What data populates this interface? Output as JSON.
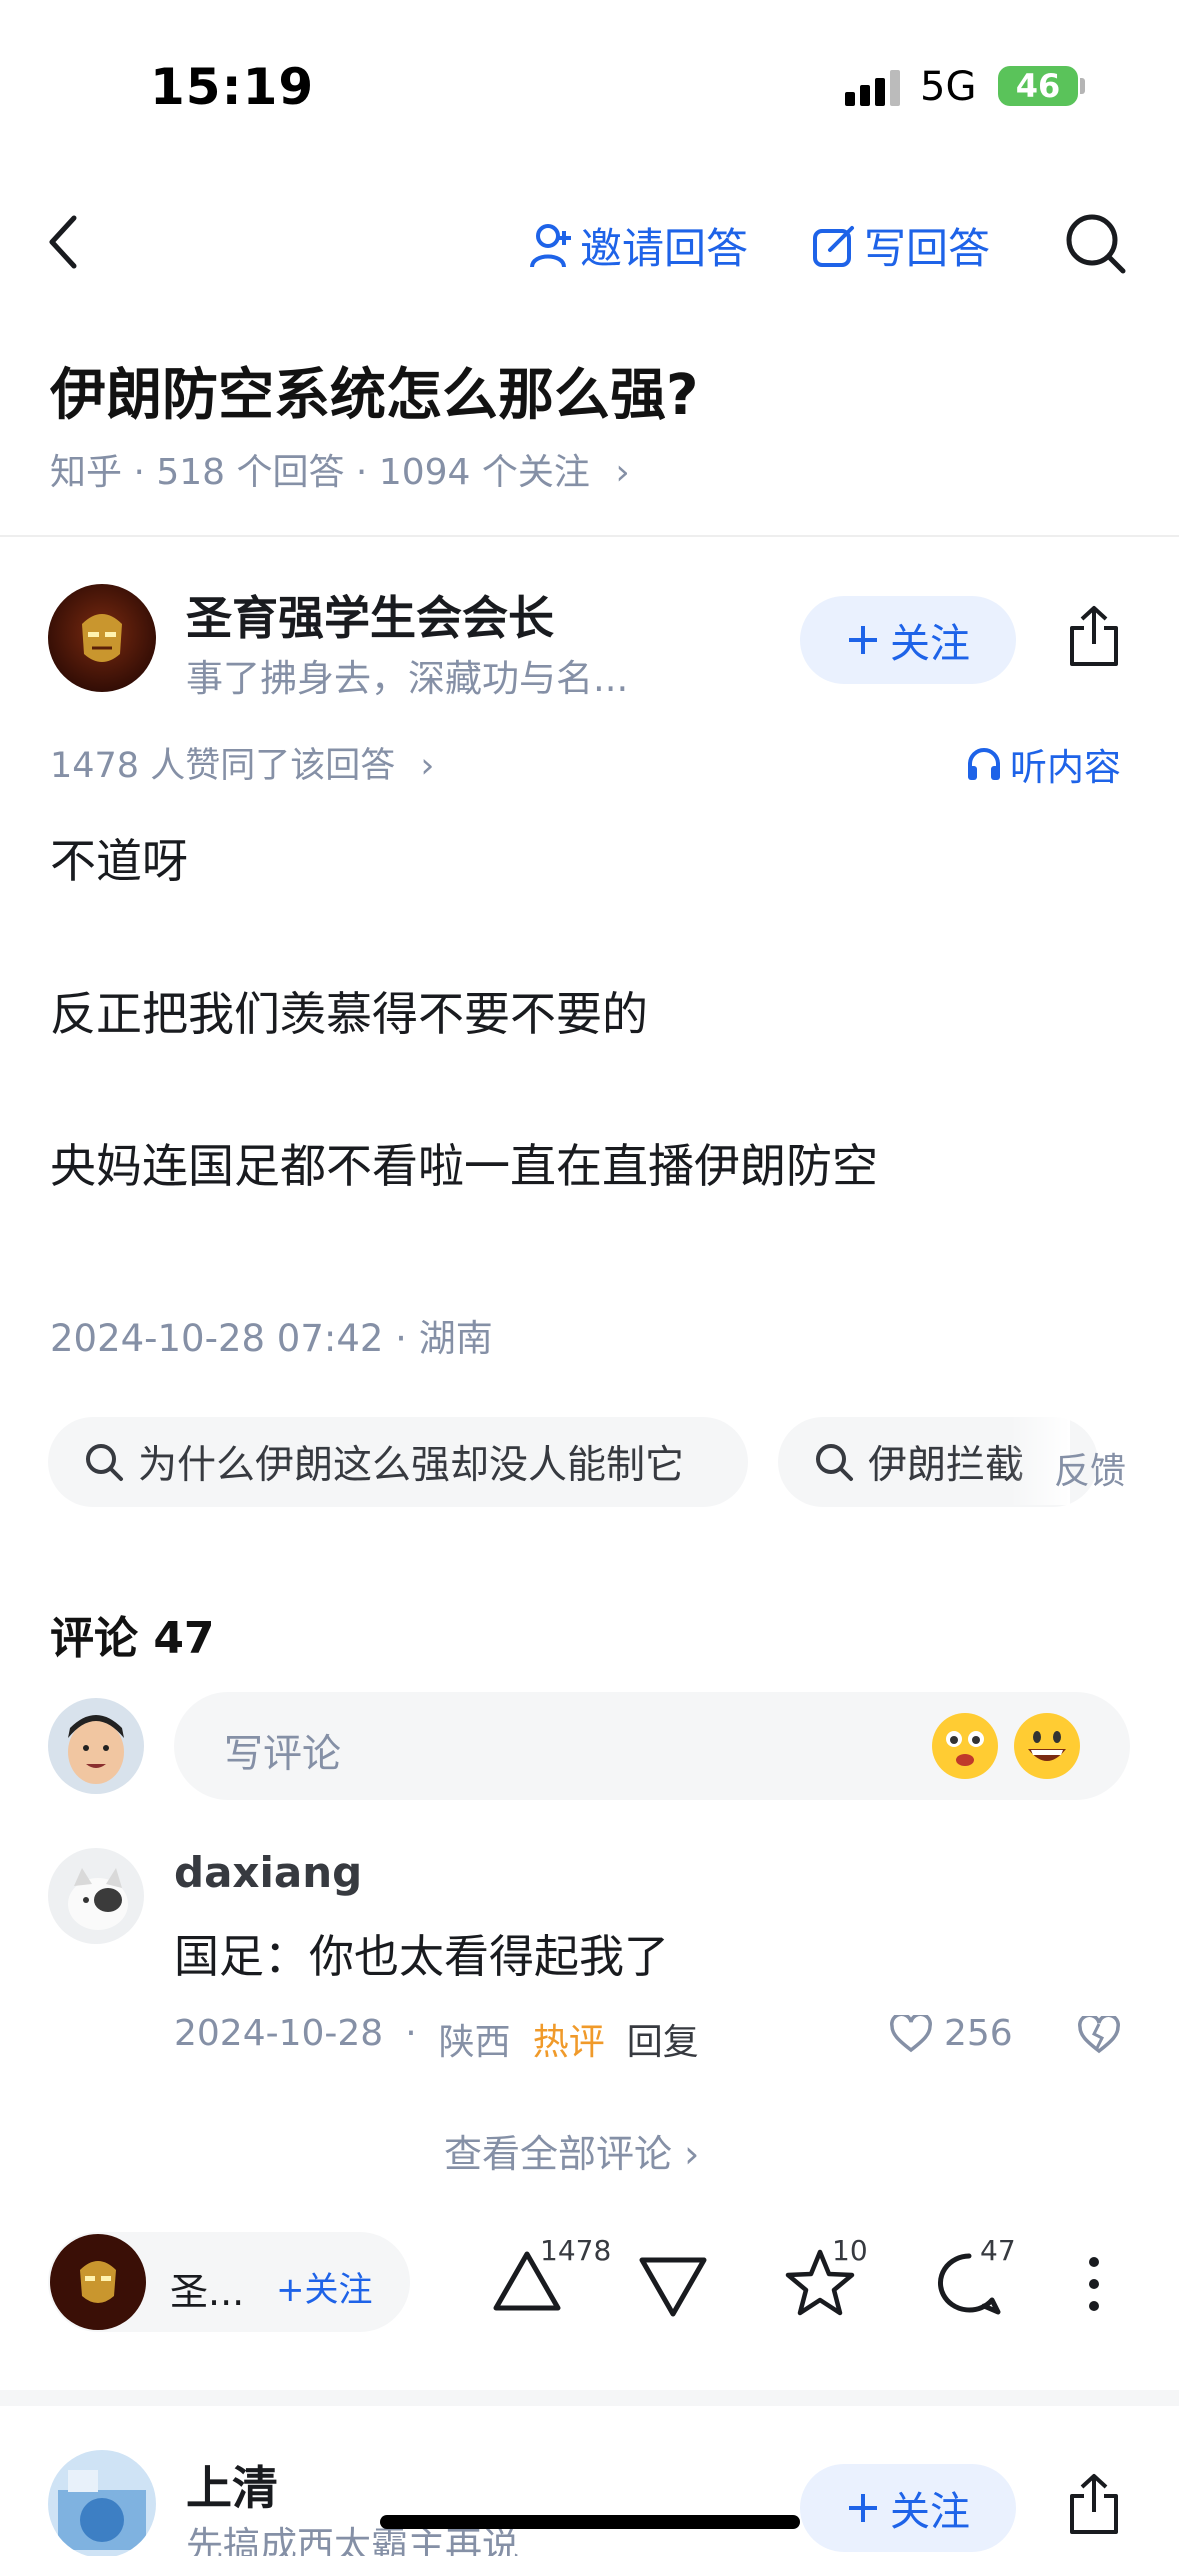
{
  "status_bar": {
    "time": "15:19",
    "network": "5G",
    "battery": "46"
  },
  "header": {
    "invite_label": "邀请回答",
    "write_label": "写回答"
  },
  "question": {
    "title": "伊朗防空系统怎么那么强?",
    "meta": "知乎 · 518 个回答 · 1094 个关注",
    "meta_chevron": "›"
  },
  "answer": {
    "author_name": "圣育强学生会会长",
    "author_bio": "事了拂身去，深藏功与名...",
    "follow_label": "关注",
    "agree_text": "1478 人赞同了该回答",
    "agree_chevron": "›",
    "listen_label": "听内容",
    "paragraphs": [
      "不道呀",
      "反正把我们羡慕得不要不要的",
      "央妈连国足都不看啦一直在直播伊朗防空"
    ],
    "date": "2024-10-28 07:42 · 湖南"
  },
  "related_searches": {
    "items": [
      "为什么伊朗这么强却没人能制它",
      "伊朗拦截"
    ],
    "feedback_label": "反馈"
  },
  "comments": {
    "title": "评论 47",
    "input_placeholder": "写评论",
    "top_comment": {
      "name": "daxiang",
      "text": "国足：你也太看得起我了",
      "date": "2024-10-28",
      "location": "陕西",
      "hot_label": "热评",
      "reply_label": "回复",
      "likes": "256"
    },
    "view_all": "查看全部评论 ›"
  },
  "bottom_bar": {
    "author_short": "圣...",
    "follow_label": "+关注",
    "upvotes": "1478",
    "stars": "10",
    "comments": "47"
  },
  "next_answer": {
    "author_name": "上清",
    "author_bio": "先搞成西太霸主再说",
    "follow_label": "关注"
  },
  "colors": {
    "accent": "#1e63e8",
    "hot": "#f09a2a",
    "muted": "#8590a6"
  }
}
